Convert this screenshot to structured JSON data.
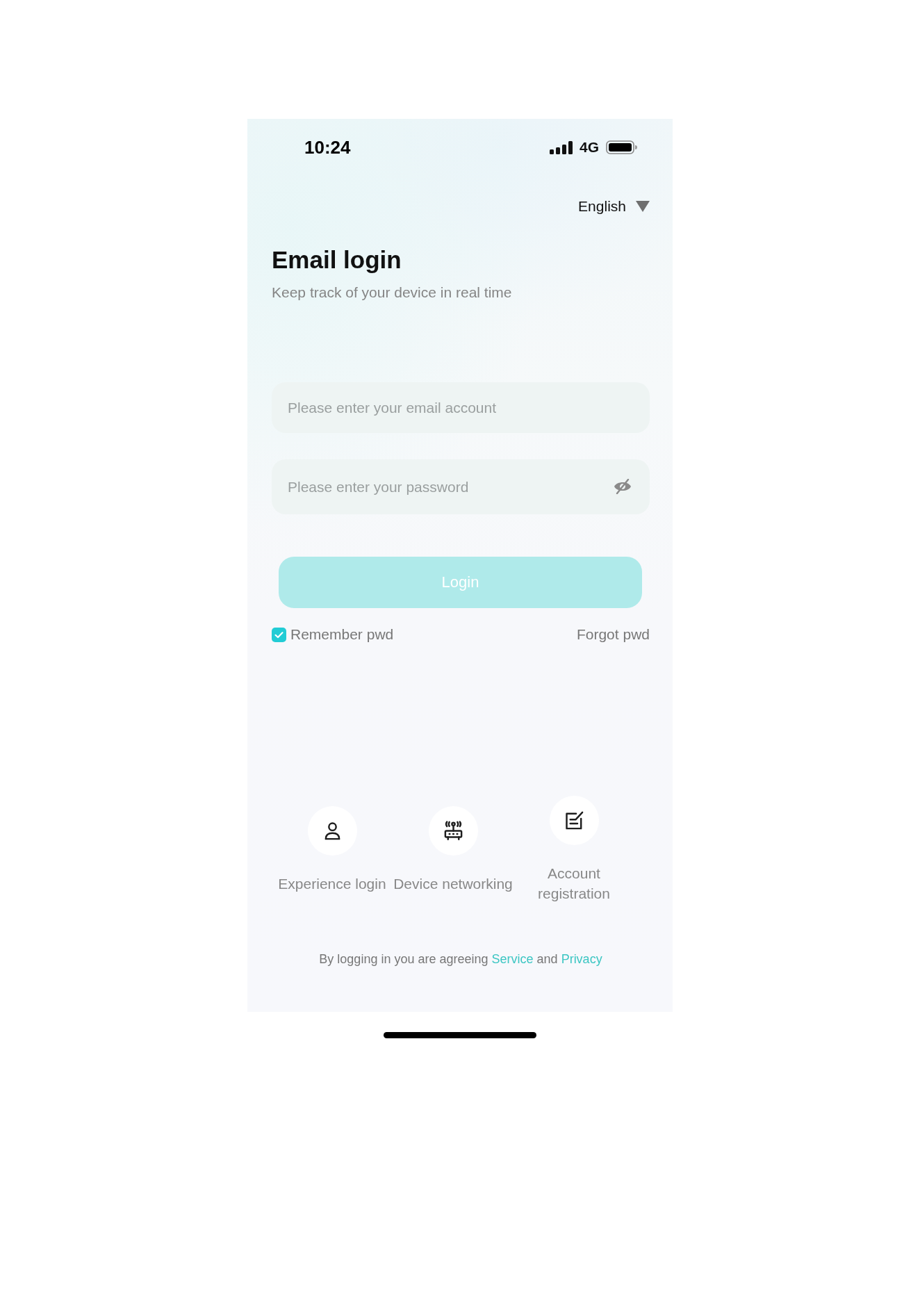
{
  "status_bar": {
    "time": "10:24",
    "network": "4G"
  },
  "language": {
    "label": "English"
  },
  "header": {
    "title": "Email login",
    "subtitle": "Keep track of your device in real time"
  },
  "fields": [
    {
      "kind": "email",
      "placeholder": "Please enter your email account"
    },
    {
      "kind": "password",
      "placeholder": "Please enter your password"
    }
  ],
  "login_button": {
    "label": "Login",
    "disabled": true
  },
  "remember": {
    "label": "Remember pwd",
    "checked": true
  },
  "forgot_link": {
    "label": "Forgot pwd"
  },
  "shortcuts": [
    {
      "label": "Experience login"
    },
    {
      "label": "Device networking"
    },
    {
      "label": "Account registration"
    }
  ],
  "agreement": [
    {
      "kind": "text",
      "text": "By logging in you are agreeing"
    },
    {
      "kind": "link",
      "text": "Service"
    },
    {
      "kind": "text",
      "text": "and"
    },
    {
      "kind": "link",
      "text": "Privacy"
    }
  ]
}
